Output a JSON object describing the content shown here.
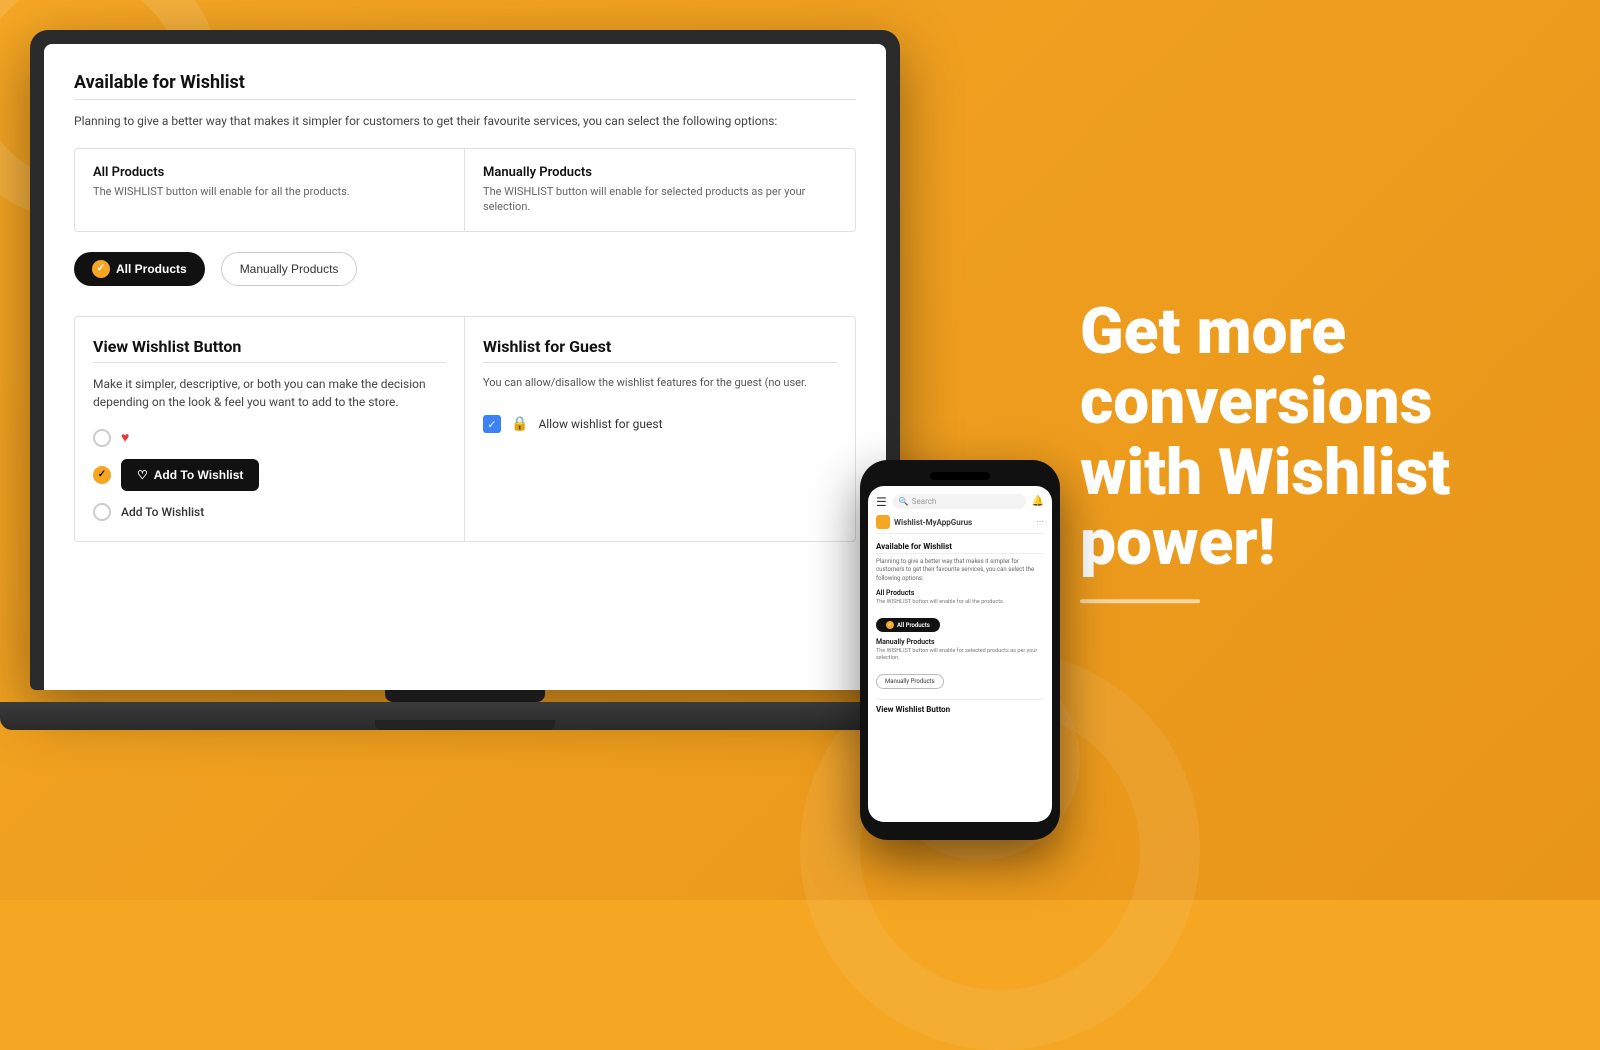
{
  "page": {
    "background_color": "#F5A623"
  },
  "laptop_screen": {
    "section1": {
      "title": "Available for Wishlist",
      "description": "Planning to give a better way that makes it simpler for customers to get their favourite services, you can select the following options:",
      "options": [
        {
          "name": "All Products",
          "desc": "The WISHLIST button will enable for all the products."
        },
        {
          "name": "Manually Products",
          "desc": "The WISHLIST button will enable for selected products as per your selection."
        }
      ],
      "btn_all_products": "All Products",
      "btn_manually_products": "Manually Products"
    },
    "section2": {
      "title": "View Wishlist Button",
      "description": "Make it simpler, descriptive, or both you can make the decision depending on the look & feel you want to add to the store.",
      "radio_options": [
        {
          "label": "heart",
          "type": "heart"
        },
        {
          "label": "Add To Wishlist",
          "type": "button-selected"
        },
        {
          "label": "Add To Wishlist",
          "type": "text"
        }
      ]
    },
    "section3": {
      "title": "Wishlist for Guest",
      "description": "You can allow/disallow the wishlist features for the guest (no user.",
      "checkbox_label": "Allow wishlist for guest"
    }
  },
  "phone_screen": {
    "search_placeholder": "Search",
    "nav_title": "Wishlist-MyAppGurus",
    "section_title": "Available for Wishlist",
    "section_desc": "Planning to give a better way that makes it simpler for customers to get their favourite services, you can select the following options:",
    "all_products_title": "All Products",
    "all_products_desc": "The WISHLIST button will enable for all the products.",
    "btn_all_products": "All Products",
    "manually_products_title": "Manually Products",
    "manually_products_desc": "The WISHLIST button will enable for selected products as per your selection.",
    "btn_manually_products": "Manually Products",
    "view_wishlist_title": "View Wishlist Button"
  },
  "right_panel": {
    "headline_line1": "Get more",
    "headline_line2": "conversions",
    "headline_line3": "with Wishlist",
    "headline_line4": "power!"
  }
}
